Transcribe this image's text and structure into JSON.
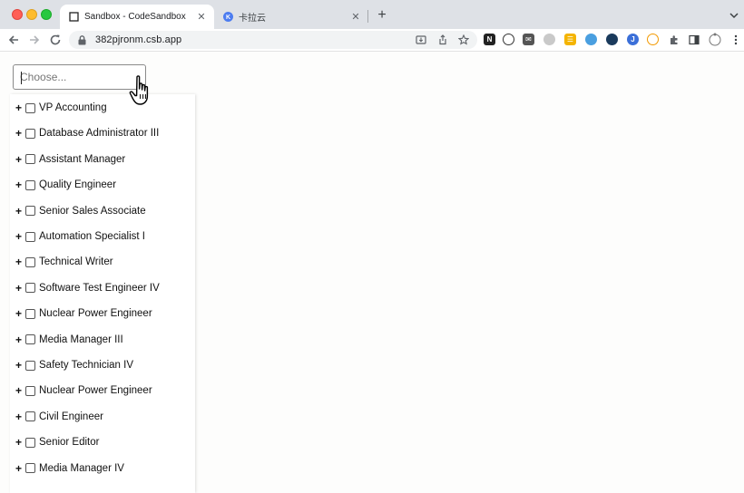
{
  "browser": {
    "tabs": [
      {
        "title": "Sandbox - CodeSandbox",
        "favicon": "codesandbox-icon",
        "active": true
      },
      {
        "title": "卡拉云",
        "favicon": "kalayun-icon",
        "active": false
      }
    ],
    "url": "382pjronm.csb.app",
    "colors": {
      "tabstrip": "#dee1e6",
      "omnibox": "#f1f3f4"
    }
  },
  "select": {
    "placeholder": "Choose...",
    "value": ""
  },
  "options": [
    {
      "label": "VP Accounting",
      "expand": "+",
      "checked": false
    },
    {
      "label": "Database Administrator III",
      "expand": "+",
      "checked": false
    },
    {
      "label": "Assistant Manager",
      "expand": "+",
      "checked": false
    },
    {
      "label": "Quality Engineer",
      "expand": "+",
      "checked": false
    },
    {
      "label": "Senior Sales Associate",
      "expand": "+",
      "checked": false
    },
    {
      "label": "Automation Specialist I",
      "expand": "+",
      "checked": false
    },
    {
      "label": "Technical Writer",
      "expand": "+",
      "checked": false
    },
    {
      "label": "Software Test Engineer IV",
      "expand": "+",
      "checked": false
    },
    {
      "label": "Nuclear Power Engineer",
      "expand": "+",
      "checked": false
    },
    {
      "label": "Media Manager III",
      "expand": "+",
      "checked": false
    },
    {
      "label": "Safety Technician IV",
      "expand": "+",
      "checked": false
    },
    {
      "label": "Nuclear Power Engineer",
      "expand": "+",
      "checked": false
    },
    {
      "label": "Civil Engineer",
      "expand": "+",
      "checked": false
    },
    {
      "label": "Senior Editor",
      "expand": "+",
      "checked": false
    },
    {
      "label": "Media Manager IV",
      "expand": "+",
      "checked": false
    }
  ]
}
